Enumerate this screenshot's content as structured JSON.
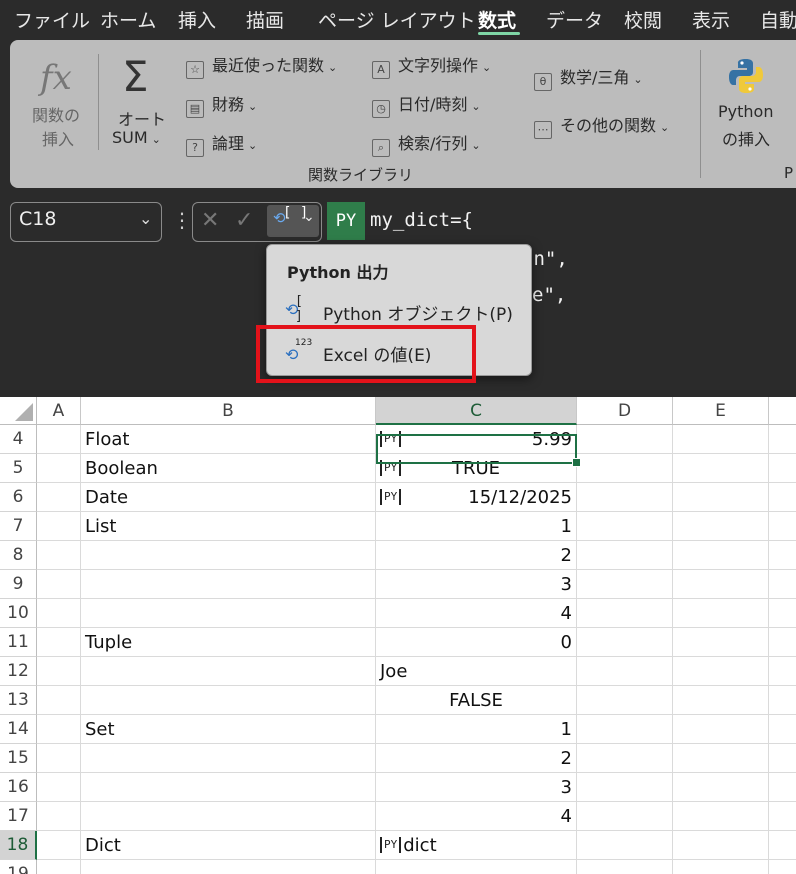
{
  "menu": {
    "items": [
      "ファイル",
      "ホーム",
      "挿入",
      "描画",
      "ページ レイアウト",
      "数式",
      "データ",
      "校閲",
      "表示",
      "自動"
    ],
    "active": "数式"
  },
  "ribbon": {
    "insert_function": {
      "line1": "関数の",
      "line2": "挿入"
    },
    "autosum": {
      "line1": "オート",
      "line2": "SUM"
    },
    "col1": [
      "最近使った関数",
      "財務",
      "論理"
    ],
    "col2": [
      "文字列操作",
      "日付/時刻",
      "検索/行列"
    ],
    "col3": [
      "数学/三角",
      "その他の関数"
    ],
    "python": {
      "line1": "Python",
      "line2": "の挿入"
    },
    "group_label": "関数ライブラリ",
    "edge_label": "P"
  },
  "formula_bar": {
    "name_box": "C18",
    "py_badge": "PY",
    "line1": "my_dict={",
    "line2_visible": "hn\",",
    "line3_visible": "e\","
  },
  "dropdown": {
    "header": "Python 出力",
    "item1": "Python オブジェクト(P)",
    "item2": "Excel の値(E)",
    "item2_icon_label": "123"
  },
  "grid": {
    "columns": [
      "A",
      "B",
      "C",
      "D",
      "E"
    ],
    "selected_column": "C",
    "selected_row": "18",
    "rows": [
      {
        "num": "4",
        "b": "Float",
        "c": "5.99",
        "py": true,
        "align": "right"
      },
      {
        "num": "5",
        "b": "Boolean",
        "c": "TRUE",
        "py": true,
        "align": "center"
      },
      {
        "num": "6",
        "b": "Date",
        "c": "15/12/2025",
        "py": true,
        "align": "right"
      },
      {
        "num": "7",
        "b": "List",
        "c": "1",
        "py": false,
        "align": "right"
      },
      {
        "num": "8",
        "b": "",
        "c": "2",
        "py": false,
        "align": "right"
      },
      {
        "num": "9",
        "b": "",
        "c": "3",
        "py": false,
        "align": "right"
      },
      {
        "num": "10",
        "b": "",
        "c": "4",
        "py": false,
        "align": "right"
      },
      {
        "num": "11",
        "b": "Tuple",
        "c": "0",
        "py": false,
        "align": "right"
      },
      {
        "num": "12",
        "b": "",
        "c": "Joe",
        "py": false,
        "align": "left"
      },
      {
        "num": "13",
        "b": "",
        "c": "FALSE",
        "py": false,
        "align": "center"
      },
      {
        "num": "14",
        "b": "Set",
        "c": "1",
        "py": false,
        "align": "right"
      },
      {
        "num": "15",
        "b": "",
        "c": "2",
        "py": false,
        "align": "right"
      },
      {
        "num": "16",
        "b": "",
        "c": "3",
        "py": false,
        "align": "right"
      },
      {
        "num": "17",
        "b": "",
        "c": "4",
        "py": false,
        "align": "right"
      },
      {
        "num": "18",
        "b": "Dict",
        "c": "dict",
        "py": true,
        "align": "left"
      },
      {
        "num": "19",
        "b": "",
        "c": "",
        "py": false,
        "align": "left"
      }
    ],
    "py_icon_label": "PY"
  },
  "colors": {
    "accent_green": "#1e7145",
    "py_badge_bg": "#2f7d4a",
    "highlight_red": "#e3121a"
  }
}
